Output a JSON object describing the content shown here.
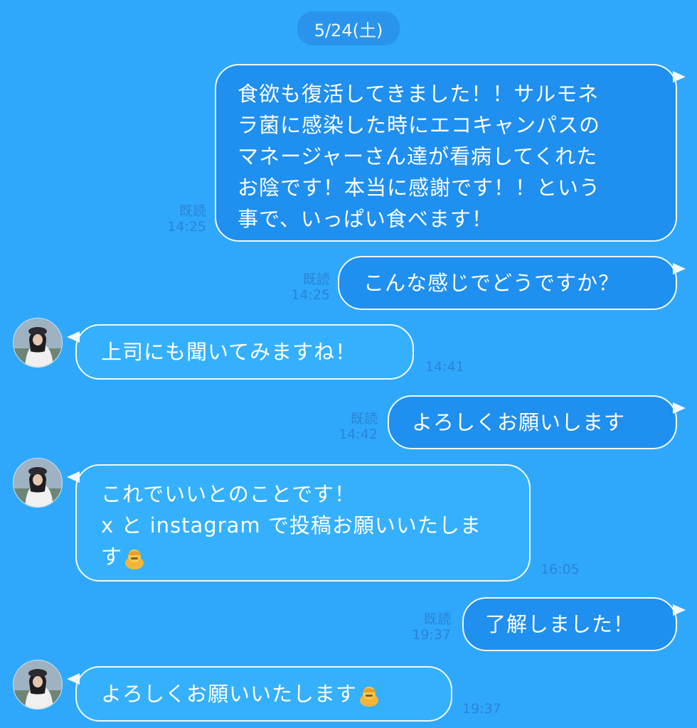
{
  "date_divider": "5/24(土)",
  "messages": [
    {
      "id": "m1",
      "side": "out",
      "text": "食欲も復活してきました！！サルモネ\nラ菌に感染した時にエコキャンパスの\nマネージャーさん達が看病してくれた\nお陰です！本当に感謝です！！という\n事で、いっぱい食べます！",
      "read": "既読",
      "time": "14:25"
    },
    {
      "id": "m2",
      "side": "out",
      "text": "こんな感じでどうですか？",
      "read": "既読",
      "time": "14:25"
    },
    {
      "id": "m3",
      "side": "in",
      "text": "上司にも聞いてみますね！",
      "time": "14:41"
    },
    {
      "id": "m4",
      "side": "out",
      "text": "よろしくお願いします",
      "read": "既読",
      "time": "14:42"
    },
    {
      "id": "m5",
      "side": "in",
      "text": "これでいいとのことです！\nx と instagram で投稿お願いいたしま\nす",
      "emoji": "bowing-person-emoji",
      "time": "16:05"
    },
    {
      "id": "m6",
      "side": "out",
      "text": "了解しました！",
      "read": "既読",
      "time": "19:37"
    },
    {
      "id": "m7",
      "side": "in",
      "text": "よろしくお願いいたします",
      "emoji": "bowing-person-emoji",
      "time": "19:37"
    }
  ],
  "colors": {
    "background": "#2fa8fb",
    "outgoing_bubble": "#1f8ff0",
    "incoming_bubble": "#35b0fd",
    "bubble_border": "#f2f9ff",
    "meta_text": "#2b83d6"
  }
}
